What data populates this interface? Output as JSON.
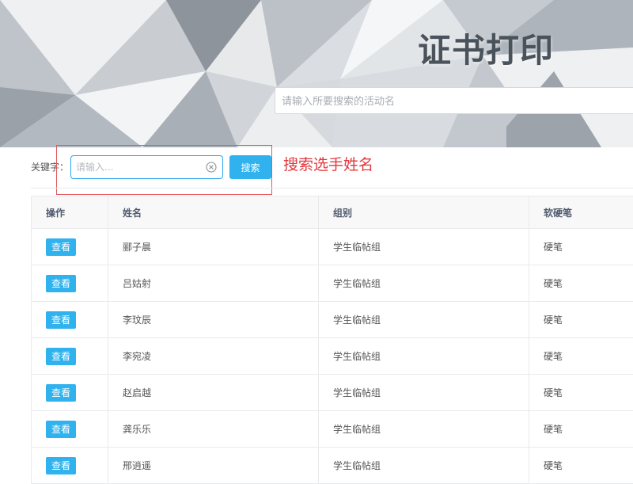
{
  "banner": {
    "title": "证书打印",
    "search_placeholder": "请输入所要搜索的活动名"
  },
  "filter": {
    "label": "关键字：",
    "input_placeholder": "请输入...",
    "search_label": "搜索"
  },
  "annotation": {
    "text": "搜索选手姓名",
    "color": "#e1383d"
  },
  "table": {
    "columns": [
      "操作",
      "姓名",
      "组别",
      "软硬笔"
    ],
    "rows": [
      {
        "action": "查看",
        "name": "郦子晨",
        "group": "学生临帖组",
        "pen": "硬笔"
      },
      {
        "action": "查看",
        "name": "吕姑射",
        "group": "学生临帖组",
        "pen": "硬笔"
      },
      {
        "action": "查看",
        "name": "李玟辰",
        "group": "学生临帖组",
        "pen": "硬笔"
      },
      {
        "action": "查看",
        "name": "李宛凌",
        "group": "学生临帖组",
        "pen": "硬笔"
      },
      {
        "action": "查看",
        "name": "赵启越",
        "group": "学生临帖组",
        "pen": "硬笔"
      },
      {
        "action": "查看",
        "name": "龚乐乐",
        "group": "学生临帖组",
        "pen": "硬笔"
      },
      {
        "action": "查看",
        "name": "邢逍遥",
        "group": "学生临帖组",
        "pen": "硬笔"
      }
    ]
  },
  "colors": {
    "accent": "#2fb2ee",
    "annotation": "#e1383d"
  },
  "icons": {
    "clear": "close-circle-icon"
  }
}
